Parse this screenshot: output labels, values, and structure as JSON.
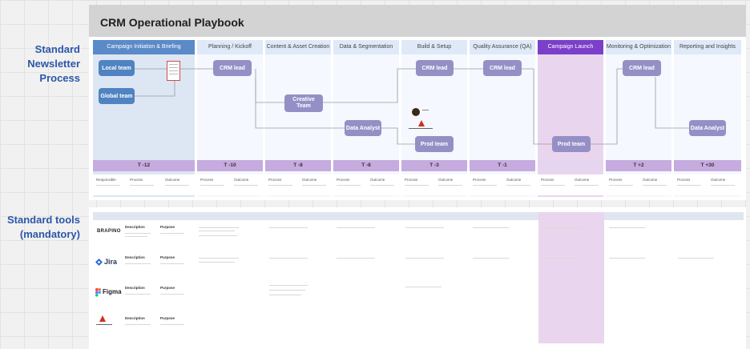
{
  "title": "CRM Operational Playbook",
  "sections": {
    "newsletter": [
      "Standard",
      "Newsletter",
      "Process"
    ],
    "tools": [
      "Standard tools",
      "(mandatory)"
    ]
  },
  "columns": [
    {
      "label": "Campaign Initiation & Briefing",
      "t": "T -12"
    },
    {
      "label": "Planning / Kickoff",
      "t": "T -10"
    },
    {
      "label": "Content & Asset Creation",
      "t": "T -8"
    },
    {
      "label": "Data & Segmentation",
      "t": "T -8"
    },
    {
      "label": "Build & Setup",
      "t": "T -3"
    },
    {
      "label": "Quality Assurance (QA)",
      "t": "T -1"
    },
    {
      "label": "Campaign Launch",
      "t": ""
    },
    {
      "label": "Monitoring & Optimization",
      "t": "T +2"
    },
    {
      "label": "Reporting and Insights",
      "t": "T +30"
    }
  ],
  "nodes": {
    "local_team": "Local team",
    "global_team": "Global team",
    "crm_lead_planning": "CRM lead",
    "creative_team": "Creative Team",
    "data_analyst_segmentation": "Data Analyst",
    "crm_lead_build": "CRM lead",
    "prod_team_build": "Prod team",
    "crm_lead_qa": "CRM lead",
    "prod_team_launch": "Prod team",
    "crm_lead_monitoring": "CRM lead",
    "data_analyst_reporting": "Data Analyst"
  },
  "row_labels": {
    "responsible": "Responsible",
    "process": "Process",
    "outcome": "Outcome"
  },
  "tools": [
    {
      "name": "BRAPINO",
      "description": "Description",
      "purpose": "Purpose"
    },
    {
      "name": "Jira",
      "description": "Description",
      "purpose": "Purpose"
    },
    {
      "name": "Figma",
      "description": "Description",
      "purpose": "Purpose"
    },
    {
      "name": "",
      "description": "Description",
      "purpose": "Purpose"
    }
  ],
  "colors": {
    "title_bg": "#d3d3d3",
    "accent_blue": "#4f83c1",
    "accent_purple": "#9490c6",
    "launch_purple": "#7b3fc9",
    "t_bar": "#c6abdf"
  }
}
